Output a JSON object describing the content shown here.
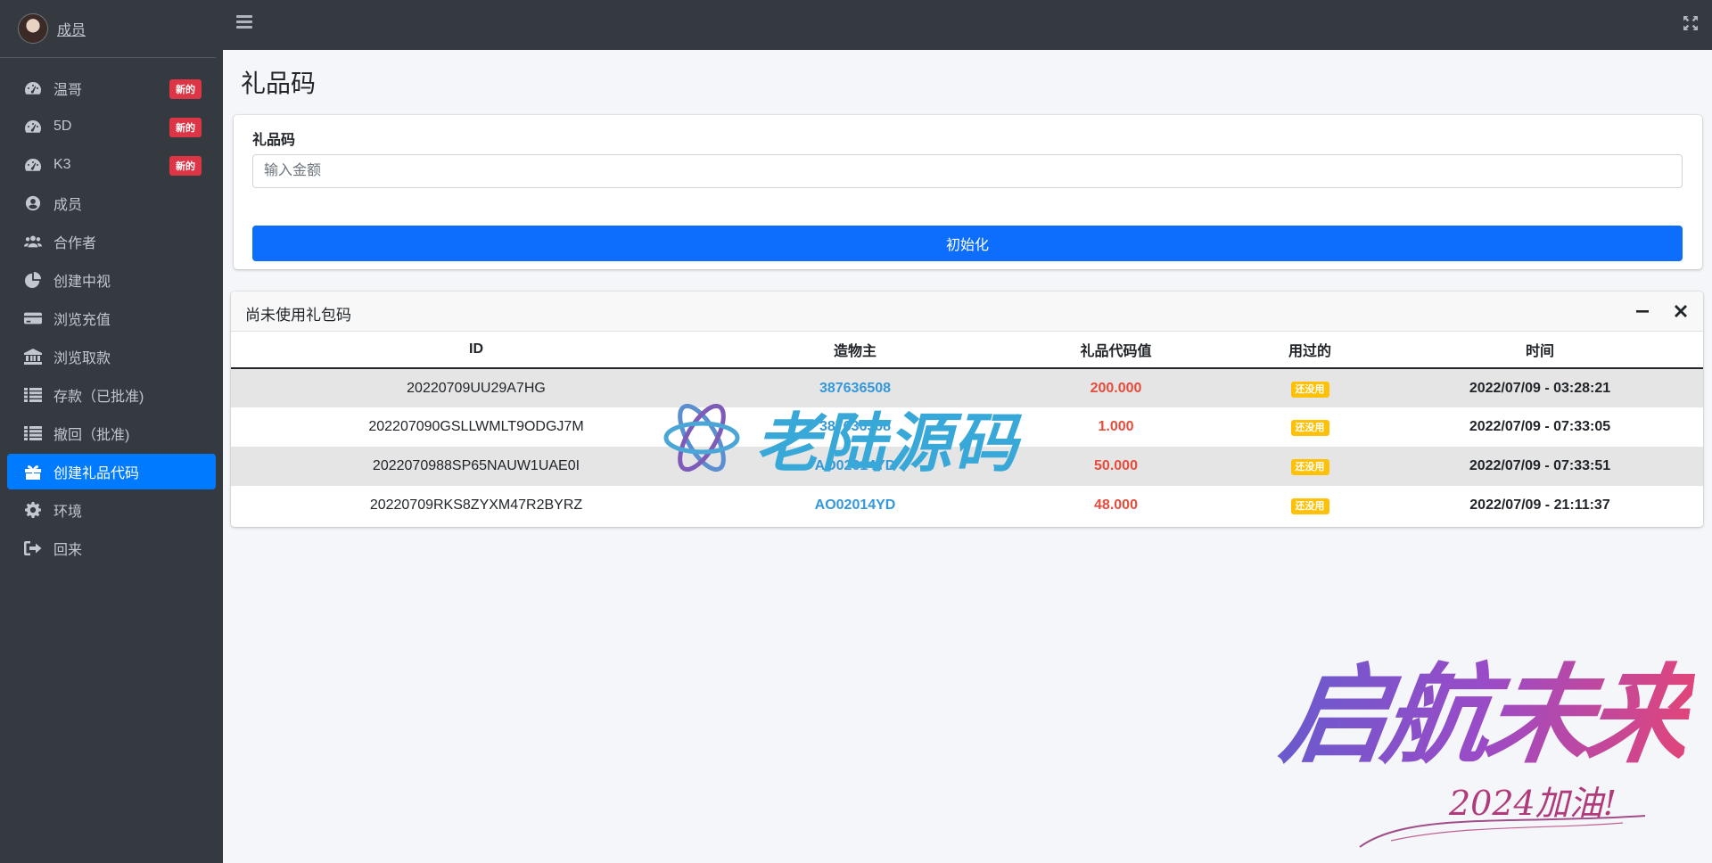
{
  "sidebar": {
    "user": {
      "name": "成员"
    },
    "items": [
      {
        "label": "温哥",
        "icon": "tachometer-icon",
        "badge": "新的"
      },
      {
        "label": "5D",
        "icon": "tachometer-icon",
        "badge": "新的"
      },
      {
        "label": "K3",
        "icon": "tachometer-icon",
        "badge": "新的"
      },
      {
        "label": "成员",
        "icon": "user-circle-icon"
      },
      {
        "label": "合作者",
        "icon": "users-icon"
      },
      {
        "label": "创建中视",
        "icon": "pie-chart-icon"
      },
      {
        "label": "浏览充值",
        "icon": "credit-card-icon"
      },
      {
        "label": "浏览取款",
        "icon": "bank-icon"
      },
      {
        "label": "存款（已批准)",
        "icon": "list-icon"
      },
      {
        "label": "撤回（批准)",
        "icon": "list-icon"
      },
      {
        "label": "创建礼品代码",
        "icon": "gift-icon",
        "active": true
      },
      {
        "label": "环境",
        "icon": "gear-icon"
      },
      {
        "label": "回来",
        "icon": "sign-out-icon"
      }
    ]
  },
  "page": {
    "title": "礼品码"
  },
  "form": {
    "label": "礼品码",
    "placeholder": "输入金额",
    "submit_label": "初始化"
  },
  "table_card": {
    "title": "尚未使用礼包码",
    "columns": [
      "ID",
      "造物主",
      "礼品代码值",
      "用过的",
      "时间"
    ],
    "rows": [
      {
        "id": "20220709UU29A7HG",
        "creator": "387636508",
        "value": "200.000",
        "used": "还没用",
        "time": "2022/07/09 - 03:28:21"
      },
      {
        "id": "202207090GSLLWMLT9ODGJ7M",
        "creator": "387636508",
        "value": "1.000",
        "used": "还没用",
        "time": "2022/07/09 - 07:33:05"
      },
      {
        "id": "2022070988SP65NAUW1UAE0I",
        "creator": "AO02014YD",
        "value": "50.000",
        "used": "还没用",
        "time": "2022/07/09 - 07:33:51"
      },
      {
        "id": "20220709RKS8ZYXM47R2BYRZ",
        "creator": "AO02014YD",
        "value": "48.000",
        "used": "还没用",
        "time": "2022/07/09 - 21:11:37"
      }
    ]
  },
  "watermarks": {
    "brand": "老陆源码",
    "slogan": "启航未来",
    "slogan_sub": "2024加油!"
  },
  "colors": {
    "sidebar_bg": "#343a40",
    "active": "#007bff",
    "primary_button": "#0d6efd",
    "badge_new": "#dc3545",
    "link": "#3498db",
    "value": "#e74c3c",
    "unused_tag": "#ffc107"
  }
}
